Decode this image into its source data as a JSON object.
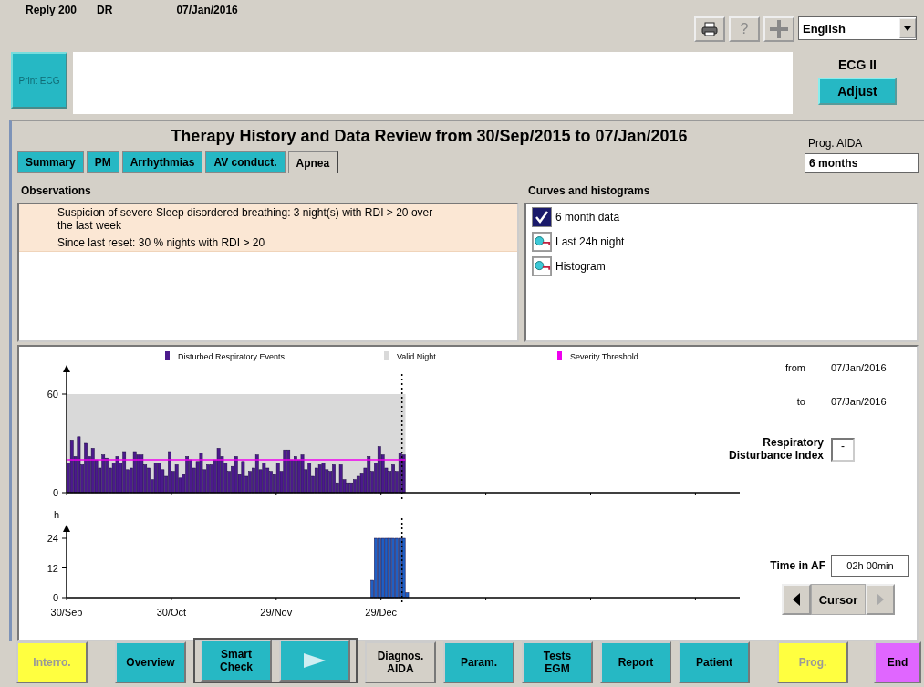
{
  "header": {
    "reply": "Reply 200",
    "mode": "DR",
    "date": "07/Jan/2016",
    "toolbar": [
      {
        "kind": "print"
      },
      {
        "kind": "help",
        "label": "?",
        "disabled": true
      },
      {
        "kind": "add"
      }
    ],
    "language": {
      "value": "English"
    }
  },
  "ecg": {
    "print_button": {
      "label": "Print ECG",
      "disabled": true
    },
    "lead": "ECG II",
    "adjust_button": "Adjust"
  },
  "review": {
    "title": "Therapy History and Data Review from 30/Sep/2015 to 07/Jan/2016",
    "tabs": [
      {
        "label": "Summary",
        "selected": false
      },
      {
        "label": "PM",
        "selected": false
      },
      {
        "label": "Arrhythmias",
        "selected": false
      },
      {
        "label": "AV conduct.",
        "selected": false
      },
      {
        "label": "Apnea",
        "selected": true
      }
    ],
    "prog_label": "Prog. AIDA",
    "prog_value": "6 months"
  },
  "observations": {
    "title": "Observations",
    "items": [
      "Suspicion of severe Sleep disordered breathing: 3 night(s) with RDI > 20 over the last week",
      "Since last reset: 30 % nights with RDI > 20"
    ]
  },
  "curves": {
    "title": "Curves and histograms",
    "items": [
      {
        "label": "6 month data",
        "kind": "checkbox",
        "checked": true
      },
      {
        "label": "Last 24h night",
        "kind": "view"
      },
      {
        "label": "Histogram",
        "kind": "view"
      }
    ]
  },
  "charts": [
    {
      "chart_data": {
        "type": "bar",
        "ylim": [
          0,
          60
        ],
        "yticks": [
          0,
          60
        ],
        "series": [
          {
            "name": "Disturbed Respiratory Events",
            "color": "#4b1a8c",
            "values": [
              18,
              32,
              22,
              34,
              17,
              30,
              22,
              27,
              20,
              15,
              23,
              21,
              15,
              18,
              22,
              18,
              25,
              14,
              15,
              25,
              23,
              23,
              17,
              15,
              8,
              18,
              18,
              14,
              10,
              25,
              13,
              17,
              9,
              11,
              22,
              20,
              15,
              19,
              24,
              14,
              17,
              17,
              20,
              27,
              22,
              18,
              13,
              16,
              22,
              11,
              19,
              10,
              13,
              15,
              23,
              14,
              18,
              15,
              13,
              11,
              18,
              13,
              26,
              26,
              20,
              22,
              20,
              23,
              14,
              18,
              10,
              15,
              17,
              18,
              14,
              13,
              17,
              6,
              17,
              8,
              6,
              6,
              8,
              10,
              12,
              15,
              22,
              13,
              18,
              28,
              23,
              15,
              13,
              17,
              13,
              24,
              23
            ]
          }
        ],
        "bands": [
          {
            "axis": "y",
            "from": 0,
            "to": 60,
            "label": "Valid Night",
            "color": "#d9d9d9"
          }
        ],
        "ref_lines": [
          {
            "axis": "y",
            "value": 20,
            "label": "Severity Threshold",
            "color": "#ee00ee"
          }
        ],
        "legend": true
      }
    },
    {
      "chart_data": {
        "type": "bar",
        "ylabel": "h",
        "ylim": [
          0,
          24
        ],
        "yticks": [
          0,
          12,
          24
        ],
        "categories": [
          "30/Sep",
          null,
          null,
          null,
          null,
          null,
          null,
          null,
          null,
          null,
          null,
          null,
          null,
          null,
          null,
          null,
          null,
          null,
          null,
          null,
          null,
          null,
          null,
          null,
          null,
          null,
          null,
          null,
          null,
          null,
          "30/Oct",
          null,
          null,
          null,
          null,
          null,
          null,
          null,
          null,
          null,
          null,
          null,
          null,
          null,
          null,
          null,
          null,
          null,
          null,
          null,
          null,
          null,
          null,
          null,
          null,
          null,
          null,
          null,
          null,
          null,
          "29/Nov",
          null,
          null,
          null,
          null,
          null,
          null,
          null,
          null,
          null,
          null,
          null,
          null,
          null,
          null,
          null,
          null,
          null,
          null,
          null,
          null,
          null,
          null,
          null,
          null,
          null,
          null,
          null,
          null,
          null,
          "29/Dec",
          null,
          null,
          null,
          null,
          null,
          null,
          null
        ],
        "series": [
          {
            "color": "#1f5fc4",
            "values": [
              null,
              null,
              null,
              null,
              null,
              null,
              null,
              null,
              null,
              null,
              null,
              null,
              null,
              null,
              null,
              null,
              null,
              null,
              null,
              null,
              null,
              null,
              null,
              null,
              null,
              null,
              null,
              null,
              null,
              null,
              null,
              null,
              null,
              null,
              null,
              null,
              null,
              null,
              null,
              null,
              null,
              null,
              null,
              null,
              null,
              null,
              null,
              null,
              null,
              null,
              null,
              null,
              null,
              null,
              null,
              null,
              null,
              null,
              null,
              null,
              null,
              null,
              null,
              null,
              null,
              null,
              null,
              null,
              null,
              null,
              null,
              null,
              null,
              null,
              null,
              null,
              null,
              null,
              null,
              null,
              null,
              null,
              null,
              null,
              null,
              null,
              null,
              7,
              24,
              24,
              24,
              24,
              24,
              24,
              24,
              24,
              24,
              2
            ]
          }
        ]
      }
    }
  ],
  "details": {
    "from_label": "from",
    "from_value": "07/Jan/2016",
    "to_label": "to",
    "to_value": "07/Jan/2016",
    "rdi_label": "Respiratory Disturbance Index",
    "rdi_value": "-",
    "af_label": "Time in AF",
    "af_value": "02h 00min",
    "cursor": {
      "label": "Cursor",
      "prev_disabled": false,
      "next_disabled": true
    }
  },
  "buttons": [
    {
      "kind": "button",
      "label": "Interro.",
      "color": "#ffff40",
      "disabled": true,
      "selected": false
    },
    {
      "kind": "button",
      "label": "Overview",
      "color": "#26b8c4",
      "disabled": false,
      "selected": false
    },
    {
      "kind": "group",
      "items": [
        {
          "kind": "button",
          "label": "Smart\nCheck",
          "color": "#26b8c4",
          "disabled": false,
          "selected": false
        },
        {
          "kind": "play",
          "color": "#26b8c4"
        }
      ]
    },
    {
      "kind": "button",
      "label": "Diagnos.\nAIDA",
      "disabled": false,
      "selected": true
    },
    {
      "kind": "button",
      "label": "Param.",
      "color": "#26b8c4",
      "disabled": false,
      "selected": false
    },
    {
      "kind": "button",
      "label": "Tests\nEGM",
      "color": "#26b8c4",
      "disabled": false,
      "selected": false
    },
    {
      "kind": "button",
      "label": "Report",
      "color": "#26b8c4",
      "disabled": false,
      "selected": false
    },
    {
      "kind": "button",
      "label": "Patient",
      "color": "#26b8c4",
      "disabled": false,
      "selected": false
    },
    {
      "kind": "button",
      "label": "Prog.",
      "color": "#ffff40",
      "disabled": true,
      "selected": false
    },
    {
      "kind": "button",
      "label": "End",
      "color": "#e066ff",
      "disabled": false,
      "selected": false
    }
  ]
}
